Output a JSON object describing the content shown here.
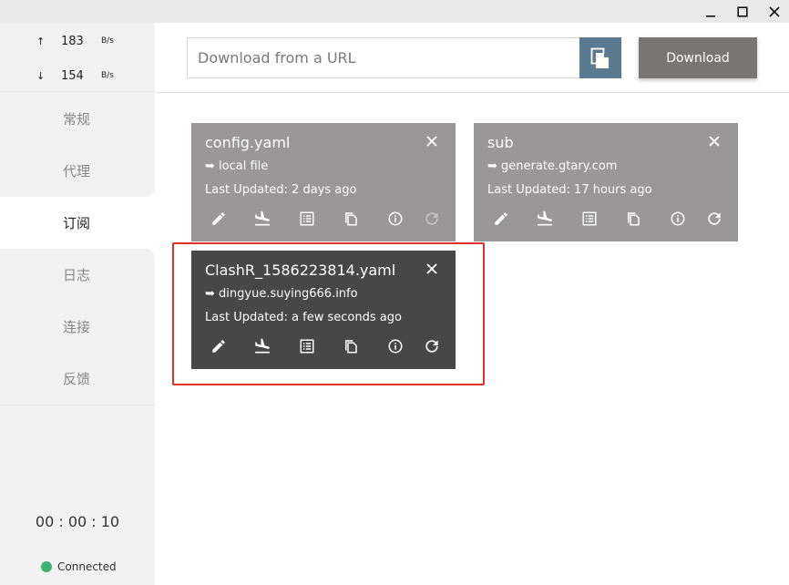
{
  "window": {
    "controls": [
      "minimize-icon",
      "maximize-icon",
      "close-icon"
    ]
  },
  "traffic": {
    "up": {
      "arrow": "↑",
      "value": "183",
      "unit": "B/s"
    },
    "down": {
      "arrow": "↓",
      "value": "154",
      "unit": "B/s"
    }
  },
  "nav": {
    "items": [
      {
        "label": "常规"
      },
      {
        "label": "代理"
      },
      {
        "label": "订阅"
      },
      {
        "label": "日志"
      },
      {
        "label": "连接"
      },
      {
        "label": "反馈"
      }
    ],
    "active_index": 2
  },
  "timer": "00 : 00 : 10",
  "status": {
    "label": "Connected",
    "color": "#3cb371"
  },
  "download": {
    "placeholder": "Download from a URL",
    "value": "",
    "button_label": "Download"
  },
  "profiles": [
    {
      "name": "config.yaml",
      "source": "➥ local file",
      "updated": "Last Updated: 2 days ago",
      "refresh_enabled": false,
      "selected": false
    },
    {
      "name": "sub",
      "source": "➥ generate.gtary.com",
      "updated": "Last Updated: 17 hours ago",
      "refresh_enabled": true,
      "selected": false
    },
    {
      "name": "ClashR_1586223814.yaml",
      "source": "➥ dingyue.suying666.info",
      "updated": "Last Updated: a few seconds ago",
      "refresh_enabled": true,
      "selected": true
    }
  ],
  "colors": {
    "card_default": "#999797",
    "card_selected": "#474747",
    "paste_button": "#5a7b8f",
    "download_button": "#777674",
    "highlight": "#e0302a"
  },
  "card_action_icons": [
    "edit-icon",
    "download-icon",
    "list-icon",
    "copy-icon",
    "info-icon",
    "refresh-icon"
  ]
}
